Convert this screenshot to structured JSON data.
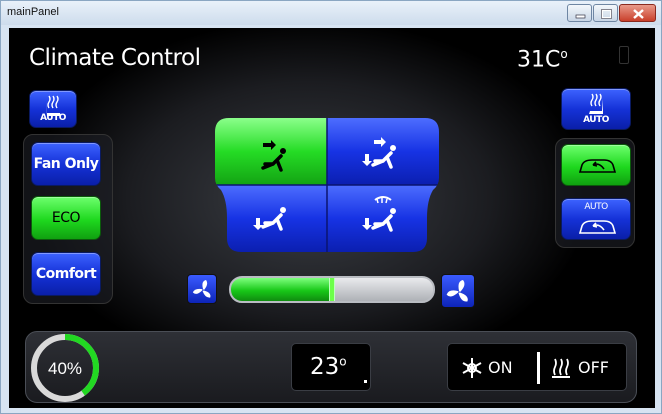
{
  "window": {
    "title": "mainPanel"
  },
  "app": {
    "title": "Climate Control",
    "outside_temp": "31C",
    "outside_temp_unit": "o"
  },
  "left_controls": {
    "seat_heat_left": {
      "label": "AUTO",
      "icon": "seat-heat-icon"
    },
    "modes": [
      {
        "label": "Fan Only",
        "active": false
      },
      {
        "label": "ECO",
        "active": true
      },
      {
        "label": "Comfort",
        "active": false
      }
    ]
  },
  "right_controls": {
    "seat_heat_right": {
      "label": "AUTO",
      "icon": "seat-heat-icon"
    },
    "recirc": {
      "icon": "car-recirculation-icon",
      "active": true
    },
    "recirc_auto": {
      "label": "AUTO",
      "icon": "car-recirculation-icon",
      "active": false
    }
  },
  "airflow": {
    "modes": [
      {
        "id": "face",
        "active": true
      },
      {
        "id": "face-feet",
        "active": false
      },
      {
        "id": "feet",
        "active": false
      },
      {
        "id": "defrost-feet",
        "active": false
      }
    ]
  },
  "fan": {
    "level": 0.5
  },
  "bottom": {
    "gauge_text": "40%",
    "gauge_value": 40,
    "set_temp": "23",
    "set_temp_unit": "o",
    "ac_label": "ON",
    "heat_label": "OFF"
  },
  "colors": {
    "active_green": "#22d822",
    "button_blue": "#1a38e0"
  }
}
